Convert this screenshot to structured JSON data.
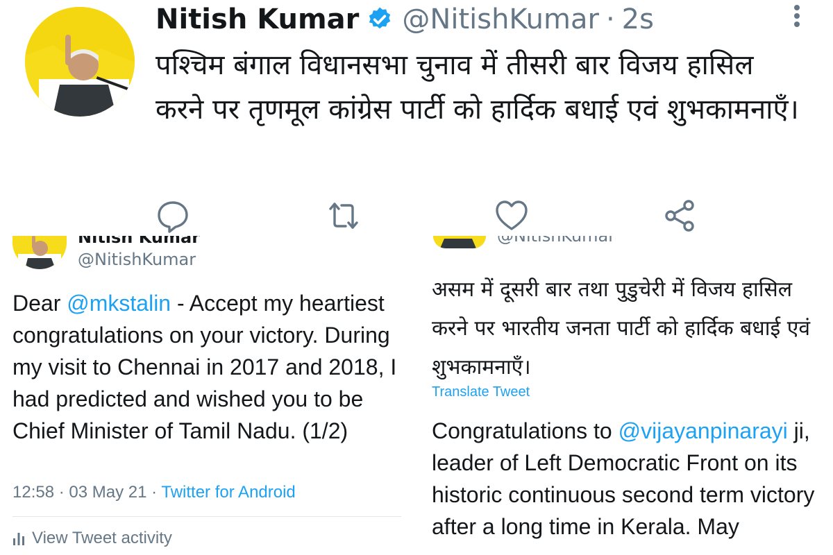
{
  "colors": {
    "link": "#1da1f2",
    "muted": "#657786",
    "text": "#14171a",
    "avatar_bg": "#f6dc1a"
  },
  "main_tweet": {
    "author_name": "Nitish Kumar",
    "handle": "@NitishKumar",
    "separator": "·",
    "time": "2s",
    "text": "पश्चिम बंगाल विधानसभा चुनाव में तीसरी बार विजय हासिल करने पर तृणमूल कांग्रेस पार्टी को हार्दिक बधाई एवं शुभकामनाएँ।",
    "icons": [
      "verified-badge-icon",
      "more-icon",
      "reply-icon",
      "retweet-icon",
      "like-icon",
      "share-icon"
    ]
  },
  "left_card": {
    "author_name_cut": "Nitish Kumar",
    "handle": "@NitishKumar",
    "text_greeting": "Dear ",
    "mention": "@mkstalin",
    "text_body": " - Accept my heartiest congratulations on your victory. During my visit to Chennai in 2017 and 2018, I had predicted and wished you to be Chief Minister of Tamil Nadu. (1/2)",
    "timestamp": "12:58 · 03 May 21 · ",
    "source": "Twitter for Android",
    "activity_label": "View Tweet activity",
    "icons": [
      "activity-bars-icon"
    ]
  },
  "right_card": {
    "handle": "@NitishKumar",
    "text_hindi": "असम में दूसरी बार तथा पुडुचेरी में विजय हासिल करने पर भारतीय जनता पार्टी को हार्दिक बधाई एवं शुभकामनाएँ।",
    "translate_label": "Translate Tweet",
    "text_prefix": "Congratulations to ",
    "mention": "@vijayanpinarayi",
    "text_body": " ji, leader of Left Democratic Front on its historic continuous second term victory after a long time in Kerala. May"
  }
}
